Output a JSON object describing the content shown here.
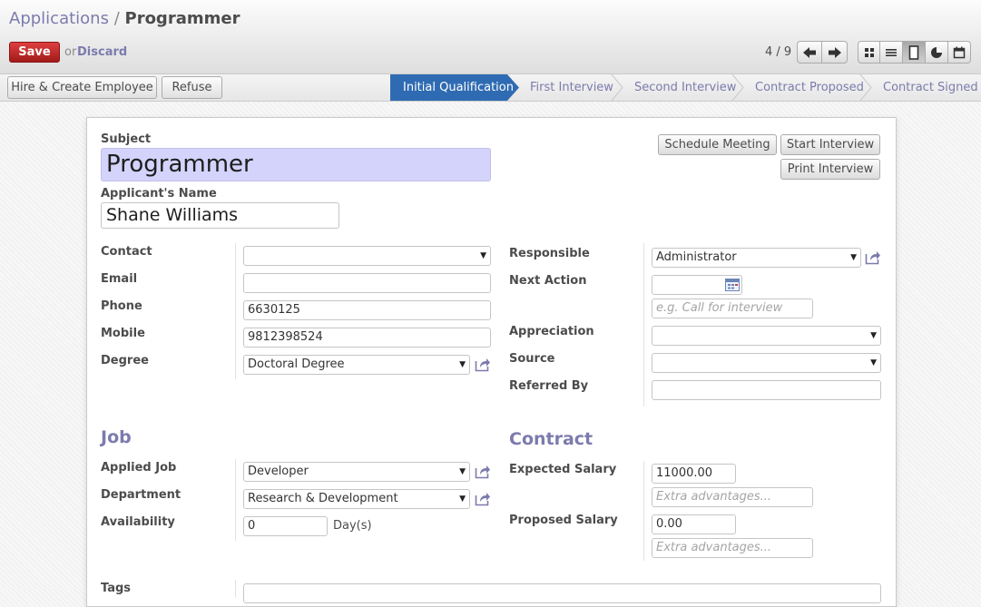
{
  "breadcrumb": {
    "parent": "Applications",
    "separator": "/",
    "current": "Programmer"
  },
  "toolbar": {
    "save": "Save",
    "or": "or",
    "discard": "Discard"
  },
  "pager": {
    "text": "4 / 9"
  },
  "actions": {
    "hire": "Hire & Create Employee",
    "refuse": "Refuse"
  },
  "stages": [
    {
      "label": "Initial Qualification",
      "active": true
    },
    {
      "label": "First Interview",
      "active": false
    },
    {
      "label": "Second Interview",
      "active": false
    },
    {
      "label": "Contract Proposed",
      "active": false
    },
    {
      "label": "Contract Signed",
      "active": false
    }
  ],
  "form": {
    "subject_label": "Subject",
    "subject": "Programmer",
    "applicant_label": "Applicant's Name",
    "applicant_name": "Shane Williams",
    "buttons": {
      "schedule": "Schedule Meeting",
      "start": "Start Interview",
      "print": "Print Interview"
    },
    "left": {
      "contact_label": "Contact",
      "contact": "",
      "email_label": "Email",
      "email": "",
      "phone_label": "Phone",
      "phone": "6630125",
      "mobile_label": "Mobile",
      "mobile": "9812398524",
      "degree_label": "Degree",
      "degree": "Doctoral Degree"
    },
    "right": {
      "responsible_label": "Responsible",
      "responsible": "Administrator",
      "next_action_label": "Next Action",
      "next_action_date": "",
      "next_action_placeholder": "e.g. Call for interview",
      "appreciation_label": "Appreciation",
      "appreciation": "",
      "source_label": "Source",
      "source": "",
      "referred_label": "Referred By",
      "referred": ""
    },
    "job": {
      "title": "Job",
      "applied_job_label": "Applied Job",
      "applied_job": "Developer",
      "department_label": "Department",
      "department": "Research & Development",
      "availability_label": "Availability",
      "availability": "0",
      "availability_unit": "Day(s)"
    },
    "contract": {
      "title": "Contract",
      "expected_label": "Expected Salary",
      "expected": "11000.00",
      "extra_placeholder": "Extra advantages...",
      "proposed_label": "Proposed Salary",
      "proposed": "0.00"
    },
    "tags_label": "Tags"
  },
  "colors": {
    "accent": "#7c7bad",
    "save": "#c82828",
    "stage_active": "#2f6bb2",
    "subject_bg": "#d3d3fb"
  },
  "icons": [
    "arrow-left-icon",
    "arrow-right-icon",
    "kanban-view-icon",
    "list-view-icon",
    "form-view-icon",
    "graph-view-icon",
    "calendar-view-icon",
    "external-link-icon",
    "calendar-icon",
    "caret-down-icon"
  ]
}
